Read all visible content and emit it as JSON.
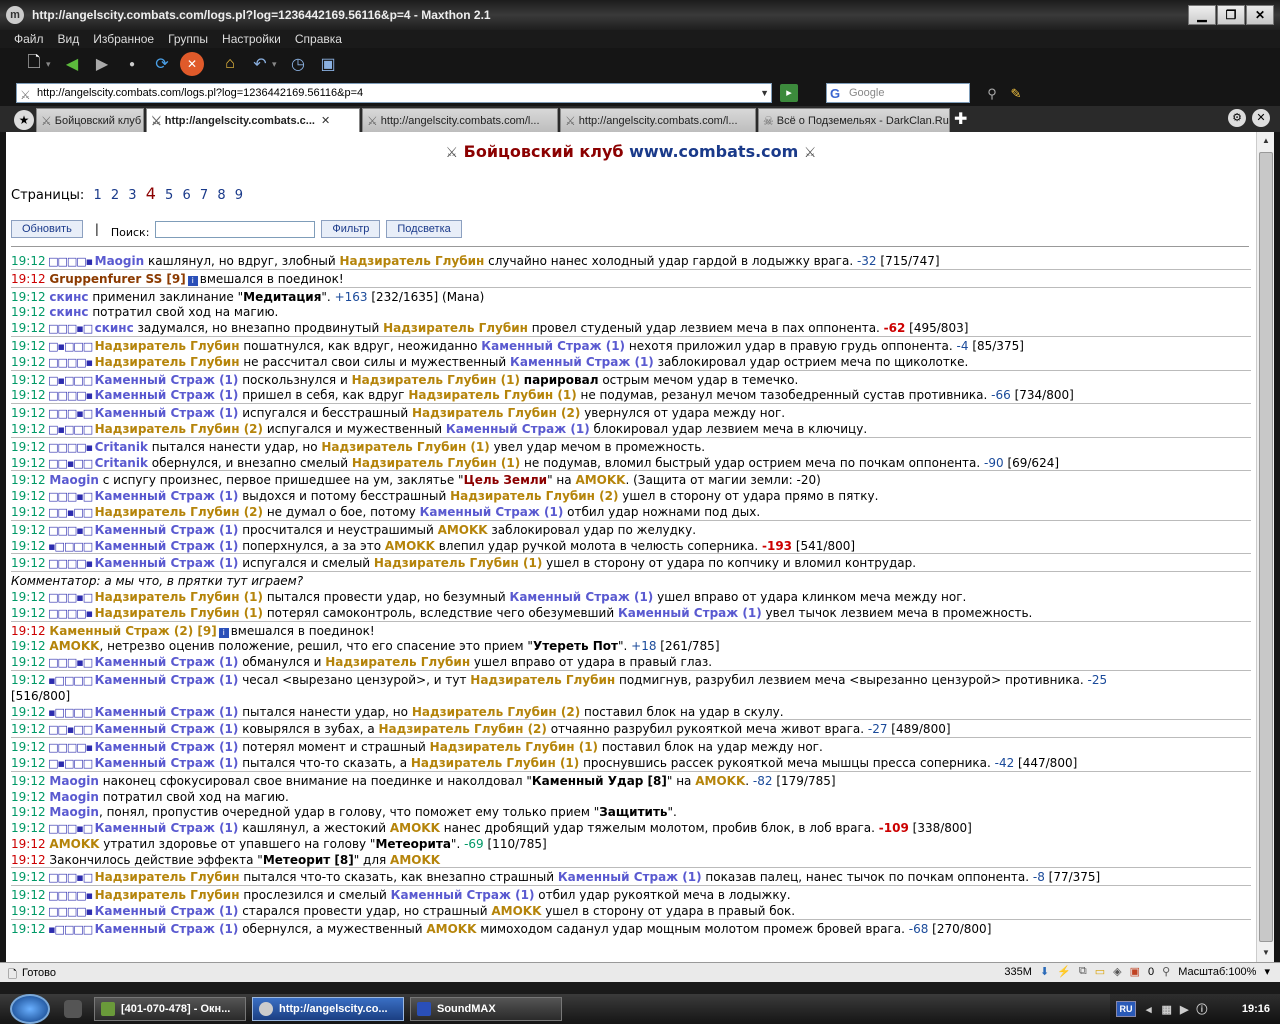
{
  "window": {
    "title": "http://angelscity.combats.com/logs.pl?log=1236442169.56116&p=4 - Maxthon 2.1"
  },
  "menu": [
    "Файл",
    "Вид",
    "Избранное",
    "Группы",
    "Настройки",
    "Справка"
  ],
  "address": {
    "url": "http://angelscity.combats.com/logs.pl?log=1236442169.56116&p=4"
  },
  "search": {
    "engine": "Google"
  },
  "tabs": [
    {
      "label": "Бойцовский клуб"
    },
    {
      "label": "http://angelscity.combats.c..."
    },
    {
      "label": "http://angelscity.combats.com/l..."
    },
    {
      "label": "http://angelscity.combats.com/l..."
    },
    {
      "label": "Всё о Подземельях - DarkClan.Ru"
    }
  ],
  "page": {
    "header_1": "Бойцовский клуб",
    "header_2": "www.combats.com",
    "pages_label": "Страницы:",
    "pages": [
      "1",
      "2",
      "3",
      "4",
      "5",
      "6",
      "7",
      "8",
      "9"
    ],
    "current_page": "4",
    "refresh": "Обновить",
    "search_label": "Поиск:",
    "filter": "Фильтр",
    "highlight": "Подсветка"
  },
  "log": [
    [
      {
        "t": "19:12",
        "c": "tm"
      },
      {
        "t": " □□□□▪ ",
        "c": "bx"
      },
      {
        "t": "Maogin",
        "c": "p1"
      },
      {
        "t": " кашлянул, но вдруг, злобный "
      },
      {
        "t": "Надзиратель Глубин",
        "c": "p2"
      },
      {
        "t": " случайно нанес холодный удар гардой в лодыжку врага. "
      },
      {
        "t": "-32",
        "c": "dmgb"
      },
      {
        "t": " [715/747]"
      }
    ],
    [
      {
        "t": "19:12",
        "c": "tm r"
      },
      {
        "t": " "
      },
      {
        "t": "Gruppenfurer SS [9]",
        "c": "pd"
      },
      {
        "t": "i",
        "c": "info"
      },
      {
        "t": "вмешался в поединок!"
      }
    ],
    [
      {
        "t": "19:12",
        "c": "tm"
      },
      {
        "t": " "
      },
      {
        "t": "скинс",
        "c": "p1"
      },
      {
        "t": " применил заклинание \""
      },
      {
        "t": "Медитация",
        "c": "bl"
      },
      {
        "t": "\". "
      },
      {
        "t": "+163",
        "c": "dmgb"
      },
      {
        "t": " [232/1635] (Мана)"
      }
    ],
    [
      {
        "t": "19:12",
        "c": "tm"
      },
      {
        "t": " "
      },
      {
        "t": "скинс",
        "c": "p1"
      },
      {
        "t": " потратил свой ход на магию."
      }
    ],
    [
      {
        "t": "19:12",
        "c": "tm"
      },
      {
        "t": " □□□▪□ ",
        "c": "bx"
      },
      {
        "t": "скинс",
        "c": "p1"
      },
      {
        "t": " задумался, но внезапно продвинутый "
      },
      {
        "t": "Надзиратель Глубин",
        "c": "p2"
      },
      {
        "t": " провел студеный удар лезвием меча в пах оппонента. "
      },
      {
        "t": "-62",
        "c": "dmg"
      },
      {
        "t": " [495/803]"
      }
    ],
    [
      {
        "t": "19:12",
        "c": "tm"
      },
      {
        "t": " □▪□□□ ",
        "c": "bx"
      },
      {
        "t": "Надзиратель Глубин",
        "c": "p2"
      },
      {
        "t": " пошатнулся, как вдруг, неожиданно "
      },
      {
        "t": "Каменный Страж (1)",
        "c": "p1"
      },
      {
        "t": " нехотя приложил удар в правую грудь оппонента. "
      },
      {
        "t": "-4",
        "c": "dmgb"
      },
      {
        "t": " [85/375]"
      }
    ],
    [
      {
        "t": "19:12",
        "c": "tm"
      },
      {
        "t": " □□□□▪ ",
        "c": "bx"
      },
      {
        "t": "Надзиратель Глубин",
        "c": "p2"
      },
      {
        "t": " не рассчитал свои силы и мужественный "
      },
      {
        "t": "Каменный Страж (1)",
        "c": "p1"
      },
      {
        "t": " заблокировал удар острием меча по щиколотке."
      }
    ],
    [
      {
        "t": "19:12",
        "c": "tm"
      },
      {
        "t": " □▪□□□ ",
        "c": "bx"
      },
      {
        "t": "Каменный Страж (1)",
        "c": "p1"
      },
      {
        "t": " поскользнулся и "
      },
      {
        "t": "Надзиратель Глубин (1)",
        "c": "p2"
      },
      {
        "t": " "
      },
      {
        "t": "парировал",
        "c": "bl"
      },
      {
        "t": " острым мечом удар в темечко."
      }
    ],
    [
      {
        "t": "19:12",
        "c": "tm"
      },
      {
        "t": " □□□□▪ ",
        "c": "bx"
      },
      {
        "t": "Каменный Страж (1)",
        "c": "p1"
      },
      {
        "t": " пришел в себя, как вдруг "
      },
      {
        "t": "Надзиратель Глубин (1)",
        "c": "p2"
      },
      {
        "t": " не подумав, резанул мечом тазобедренный сустав противника. "
      },
      {
        "t": "-66",
        "c": "dmgb"
      },
      {
        "t": " [734/800]"
      }
    ],
    [
      {
        "t": "19:12",
        "c": "tm"
      },
      {
        "t": " □□□▪□ ",
        "c": "bx"
      },
      {
        "t": "Каменный Страж (1)",
        "c": "p1"
      },
      {
        "t": " испугался и бесстрашный "
      },
      {
        "t": "Надзиратель Глубин (2)",
        "c": "p2"
      },
      {
        "t": " увернулся от удара между ног."
      }
    ],
    [
      {
        "t": "19:12",
        "c": "tm"
      },
      {
        "t": " □▪□□□ ",
        "c": "bx"
      },
      {
        "t": "Надзиратель Глубин (2)",
        "c": "p2"
      },
      {
        "t": " испугался и мужественный "
      },
      {
        "t": "Каменный Страж (1)",
        "c": "p1"
      },
      {
        "t": " блокировал удар лезвием меча в ключицу."
      }
    ],
    [
      {
        "t": "19:12",
        "c": "tm"
      },
      {
        "t": " □□□□▪ ",
        "c": "bx"
      },
      {
        "t": "Critanik",
        "c": "p1"
      },
      {
        "t": " пытался нанести удар, но "
      },
      {
        "t": "Надзиратель Глубин (1)",
        "c": "p2"
      },
      {
        "t": " увел удар мечом в промежность."
      }
    ],
    [
      {
        "t": "19:12",
        "c": "tm"
      },
      {
        "t": " □□▪□□ ",
        "c": "bx"
      },
      {
        "t": "Critanik",
        "c": "p1"
      },
      {
        "t": " обернулся, и внезапно смелый "
      },
      {
        "t": "Надзиратель Глубин (1)",
        "c": "p2"
      },
      {
        "t": " не подумав, вломил быстрый удар острием меча по почкам оппонента. "
      },
      {
        "t": "-90",
        "c": "dmgb"
      },
      {
        "t": " [69/624]"
      }
    ],
    [
      {
        "t": "19:12",
        "c": "tm"
      },
      {
        "t": " "
      },
      {
        "t": "Maogin",
        "c": "p1"
      },
      {
        "t": " с испугу произнес, первое пришедшее на ум, заклятье \""
      },
      {
        "t": "Цель Земли",
        "c": "spell"
      },
      {
        "t": "\" на "
      },
      {
        "t": "AMOKK",
        "c": "pb"
      },
      {
        "t": ". (Защита от магии земли: -20)"
      }
    ],
    [
      {
        "t": "19:12",
        "c": "tm"
      },
      {
        "t": " □□□▪□ ",
        "c": "bx"
      },
      {
        "t": "Каменный Страж (1)",
        "c": "p1"
      },
      {
        "t": " выдохся и потому бесстрашный "
      },
      {
        "t": "Надзиратель Глубин (2)",
        "c": "p2"
      },
      {
        "t": " ушел в сторону от удара прямо в пятку."
      }
    ],
    [
      {
        "t": "19:12",
        "c": "tm"
      },
      {
        "t": " □□▪□□ ",
        "c": "bx"
      },
      {
        "t": "Надзиратель Глубин (2)",
        "c": "p2"
      },
      {
        "t": " не думал о бое, потому "
      },
      {
        "t": "Каменный Страж (1)",
        "c": "p1"
      },
      {
        "t": " отбил удар ножнами под дых."
      }
    ],
    [
      {
        "t": "19:12",
        "c": "tm"
      },
      {
        "t": " □□□▪□ ",
        "c": "bx"
      },
      {
        "t": "Каменный Страж (1)",
        "c": "p1"
      },
      {
        "t": " просчитался и неустрашимый "
      },
      {
        "t": "AMOKK",
        "c": "pb"
      },
      {
        "t": " заблокировал удар по желудку."
      }
    ],
    [
      {
        "t": "19:12",
        "c": "tm"
      },
      {
        "t": " ▪□□□□ ",
        "c": "bx"
      },
      {
        "t": "Каменный Страж (1)",
        "c": "p1"
      },
      {
        "t": " поперхнулся, а за это "
      },
      {
        "t": "AMOKK",
        "c": "pb"
      },
      {
        "t": " влепил удар ручкой молота в челюсть соперника. "
      },
      {
        "t": "-193",
        "c": "dmg"
      },
      {
        "t": " [541/800]"
      }
    ],
    [
      {
        "t": "19:12",
        "c": "tm"
      },
      {
        "t": " □□□□▪ ",
        "c": "bx"
      },
      {
        "t": "Каменный Страж (1)",
        "c": "p1"
      },
      {
        "t": " испугался и смелый "
      },
      {
        "t": "Надзиратель Глубин (1)",
        "c": "p2"
      },
      {
        "t": " ушел в сторону от удара по копчику и вломил контрудар."
      }
    ],
    [
      {
        "t": "Комментатор: а мы что, в прятки тут играем?",
        "c": "com"
      }
    ],
    [
      {
        "t": "19:12",
        "c": "tm"
      },
      {
        "t": " □□□▪□ ",
        "c": "bx"
      },
      {
        "t": "Надзиратель Глубин (1)",
        "c": "p2"
      },
      {
        "t": " пытался провести удар, но безумный "
      },
      {
        "t": "Каменный Страж (1)",
        "c": "p1"
      },
      {
        "t": " ушел вправо от удара клинком меча между ног."
      }
    ],
    [
      {
        "t": "19:12",
        "c": "tm"
      },
      {
        "t": " □□□□▪ ",
        "c": "bx"
      },
      {
        "t": "Надзиратель Глубин (1)",
        "c": "p2"
      },
      {
        "t": " потерял самоконтроль, вследствие чего обезумевший "
      },
      {
        "t": "Каменный Страж (1)",
        "c": "p1"
      },
      {
        "t": " увел тычок лезвием меча в промежность."
      }
    ],
    [
      {
        "t": "19:12",
        "c": "tm r"
      },
      {
        "t": " "
      },
      {
        "t": "Каменный Страж (2) [9]",
        "c": "pb"
      },
      {
        "t": "i",
        "c": "info"
      },
      {
        "t": "вмешался в поединок!"
      }
    ],
    [
      {
        "t": "19:12",
        "c": "tm"
      },
      {
        "t": " "
      },
      {
        "t": "AMOKK",
        "c": "pb"
      },
      {
        "t": ", нетрезво оценив положение, решил, что его спасение это прием \""
      },
      {
        "t": "Утереть Пот",
        "c": "bl"
      },
      {
        "t": "\". "
      },
      {
        "t": "+18",
        "c": "dmgb"
      },
      {
        "t": " [261/785]"
      }
    ],
    [
      {
        "t": "19:12",
        "c": "tm"
      },
      {
        "t": " □□□▪□ ",
        "c": "bx"
      },
      {
        "t": "Каменный Страж (1)",
        "c": "p1"
      },
      {
        "t": " обманулся и "
      },
      {
        "t": "Надзиратель Глубин",
        "c": "p2"
      },
      {
        "t": " ушел вправо от удара в правый глаз."
      }
    ],
    [
      {
        "t": "19:12",
        "c": "tm"
      },
      {
        "t": " ▪□□□□ ",
        "c": "bx"
      },
      {
        "t": "Каменный Страж (1)",
        "c": "p1"
      },
      {
        "t": " чесал <вырезано цензурой>, и тут "
      },
      {
        "t": "Надзиратель Глубин",
        "c": "p2"
      },
      {
        "t": " подмигнув, разрубил лезвием меча <вырезанно цензурой> противника. "
      },
      {
        "t": "-25",
        "c": "dmgb"
      }
    ],
    [
      {
        "t": "[516/800]"
      }
    ],
    [
      {
        "t": "19:12",
        "c": "tm"
      },
      {
        "t": " ▪□□□□ ",
        "c": "bx"
      },
      {
        "t": "Каменный Страж (1)",
        "c": "p1"
      },
      {
        "t": " пытался нанести удар, но "
      },
      {
        "t": "Надзиратель Глубин (2)",
        "c": "p2"
      },
      {
        "t": " поставил блок на удар в скулу."
      }
    ],
    [
      {
        "t": "19:12",
        "c": "tm"
      },
      {
        "t": " □□▪□□ ",
        "c": "bx"
      },
      {
        "t": "Каменный Страж (1)",
        "c": "p1"
      },
      {
        "t": " ковырялся в зубах, а "
      },
      {
        "t": "Надзиратель Глубин (2)",
        "c": "p2"
      },
      {
        "t": " отчаянно разрубил рукояткой меча живот врага. "
      },
      {
        "t": "-27",
        "c": "dmgb"
      },
      {
        "t": " [489/800]"
      }
    ],
    [
      {
        "t": "19:12",
        "c": "tm"
      },
      {
        "t": " □□□□▪ ",
        "c": "bx"
      },
      {
        "t": "Каменный Страж (1)",
        "c": "p1"
      },
      {
        "t": " потерял момент и страшный "
      },
      {
        "t": "Надзиратель Глубин (1)",
        "c": "p2"
      },
      {
        "t": " поставил блок на удар между ног."
      }
    ],
    [
      {
        "t": "19:12",
        "c": "tm"
      },
      {
        "t": " □▪□□□ ",
        "c": "bx"
      },
      {
        "t": "Каменный Страж (1)",
        "c": "p1"
      },
      {
        "t": " пытался что-то сказать, а "
      },
      {
        "t": "Надзиратель Глубин (1)",
        "c": "p2"
      },
      {
        "t": " проснувшись рассек рукояткой меча мышцы пресса соперника. "
      },
      {
        "t": "-42",
        "c": "dmgb"
      },
      {
        "t": " [447/800]"
      }
    ],
    [
      {
        "t": "19:12",
        "c": "tm"
      },
      {
        "t": " "
      },
      {
        "t": "Maogin",
        "c": "p1"
      },
      {
        "t": " наконец сфокусировал свое внимание на поединке и наколдовал \""
      },
      {
        "t": "Каменный Удар [8]",
        "c": "bl"
      },
      {
        "t": "\" на "
      },
      {
        "t": "AMOKK",
        "c": "pb"
      },
      {
        "t": ". "
      },
      {
        "t": "-82",
        "c": "dmgb"
      },
      {
        "t": " [179/785]"
      }
    ],
    [
      {
        "t": "19:12",
        "c": "tm"
      },
      {
        "t": " "
      },
      {
        "t": "Maogin",
        "c": "p1"
      },
      {
        "t": " потратил свой ход на магию."
      }
    ],
    [
      {
        "t": "19:12",
        "c": "tm"
      },
      {
        "t": " "
      },
      {
        "t": "Maogin",
        "c": "p1"
      },
      {
        "t": ", понял, пропустив очередной удар в голову, что поможет ему только прием \""
      },
      {
        "t": "Защитить",
        "c": "bl"
      },
      {
        "t": "\"."
      }
    ],
    [
      {
        "t": "19:12",
        "c": "tm"
      },
      {
        "t": " □□□▪□ ",
        "c": "bx"
      },
      {
        "t": "Каменный Страж (1)",
        "c": "p1"
      },
      {
        "t": " кашлянул, а жестокий "
      },
      {
        "t": "AMOKK",
        "c": "pb"
      },
      {
        "t": " нанес дробящий удар тяжелым молотом, пробив блок, в лоб врага. "
      },
      {
        "t": "-109",
        "c": "dmg"
      },
      {
        "t": " [338/800]"
      }
    ],
    [
      {
        "t": "19:12",
        "c": "tm r"
      },
      {
        "t": " "
      },
      {
        "t": "AMOKK",
        "c": "pb"
      },
      {
        "t": " утратил здоровье от упавшего на голову \""
      },
      {
        "t": "Метеорита",
        "c": "bl"
      },
      {
        "t": "\". "
      },
      {
        "t": "-69",
        "c": "tm"
      },
      {
        "t": " [110/785]"
      }
    ],
    [
      {
        "t": "19:12",
        "c": "tm r"
      },
      {
        "t": " Закончилось действие эффекта \""
      },
      {
        "t": "Метеорит [8]",
        "c": "bl"
      },
      {
        "t": "\" для "
      },
      {
        "t": "AMOKK",
        "c": "pb"
      }
    ],
    [
      {
        "t": "19:12",
        "c": "tm"
      },
      {
        "t": " □□□▪□ ",
        "c": "bx"
      },
      {
        "t": "Надзиратель Глубин",
        "c": "p2"
      },
      {
        "t": " пытался что-то сказать, как внезапно страшный "
      },
      {
        "t": "Каменный Страж (1)",
        "c": "p1"
      },
      {
        "t": " показав палец, нанес тычок по почкам оппонента. "
      },
      {
        "t": "-8",
        "c": "dmgb"
      },
      {
        "t": " [77/375]"
      }
    ],
    [
      {
        "t": "19:12",
        "c": "tm"
      },
      {
        "t": " □□□□▪ ",
        "c": "bx"
      },
      {
        "t": "Надзиратель Глубин",
        "c": "p2"
      },
      {
        "t": " прослезился и смелый "
      },
      {
        "t": "Каменный Страж (1)",
        "c": "p1"
      },
      {
        "t": " отбил удар рукояткой меча в лодыжку."
      }
    ],
    [
      {
        "t": "19:12",
        "c": "tm"
      },
      {
        "t": " □□□□▪ ",
        "c": "bx"
      },
      {
        "t": "Каменный Страж (1)",
        "c": "p1"
      },
      {
        "t": " старался провести удар, но страшный "
      },
      {
        "t": "AMOKK",
        "c": "pb"
      },
      {
        "t": " ушел в сторону от удара в правый бок."
      }
    ],
    [
      {
        "t": "19:12",
        "c": "tm"
      },
      {
        "t": " ▪□□□□ ",
        "c": "bx"
      },
      {
        "t": "Каменный Страж (1)",
        "c": "p1"
      },
      {
        "t": " обернулся, а мужественный "
      },
      {
        "t": "AMOKK",
        "c": "pb"
      },
      {
        "t": " мимоходом саданул удар мощным молотом промеж бровей врага. "
      },
      {
        "t": "-68",
        "c": "dmgb"
      },
      {
        "t": " [270/800]"
      }
    ]
  ],
  "groups_end": [
    0,
    1,
    4,
    6,
    8,
    10,
    12,
    15,
    17,
    18,
    21,
    24,
    27,
    28,
    30,
    36,
    37,
    39,
    41
  ],
  "status": {
    "text": "Готово",
    "mem": "335M",
    "counter": "0",
    "zoom": "Масштаб:100%"
  },
  "taskbar": {
    "tasks": [
      "[401-070-478] - Окн...",
      "http://angelscity.co...",
      "SoundMAX"
    ],
    "lang": "RU",
    "clock": "19:16"
  }
}
